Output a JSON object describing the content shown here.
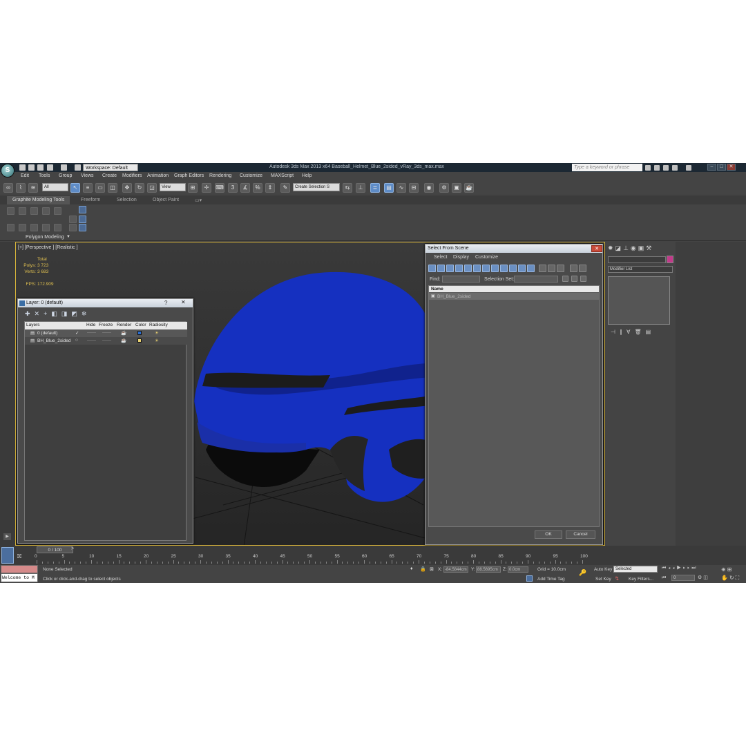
{
  "app": {
    "window_title": "Autodesk 3ds Max  2013 x64      Baseball_Helmet_Blue_2sided_vRay_3ds_max.max",
    "workspace": "Workspace: Default",
    "search_placeholder": "Type a keyword or phrase"
  },
  "menu": [
    "Edit",
    "Tools",
    "Group",
    "Views",
    "Create",
    "Modifiers",
    "Animation",
    "Graph Editors",
    "Rendering",
    "Customize",
    "MAXScript",
    "Help"
  ],
  "toolbar": {
    "filter": "All",
    "ref_coord": "View",
    "selection_set": "Create Selection S"
  },
  "ribbon": {
    "tabs": [
      "Graphite Modeling Tools",
      "Freeform",
      "Selection",
      "Object Paint"
    ],
    "panel_label": "Polygon Modeling"
  },
  "viewport": {
    "label": "[+] [Perspective ] [Realistic ]",
    "stats_header": "Total",
    "polys_label": "Polys:",
    "polys_value": "3 723",
    "verts_label": "Verts:",
    "verts_value": "3 683",
    "fps_label": "FPS:",
    "fps_value": "172.909",
    "helmet_color": "#1530c0"
  },
  "layer_dialog": {
    "title": "Layer: 0 (default)",
    "help": "?",
    "close": "✕",
    "columns": [
      "Layers",
      "Hide",
      "Freeze",
      "Render",
      "Color",
      "Radiosity"
    ],
    "rows": [
      {
        "name": "0 (default)",
        "hide": "——",
        "freeze": "——"
      },
      {
        "name": "BH_Blue_2sided",
        "hide": "——",
        "freeze": "——"
      }
    ]
  },
  "select_dialog": {
    "title": "Select From Scene",
    "menu": [
      "Select",
      "Display",
      "Customize"
    ],
    "find_label": "Find:",
    "selection_set_label": "Selection Set:",
    "column_name": "Name",
    "items": [
      "BH_Blue_2sided"
    ],
    "ok": "OK",
    "cancel": "Cancel"
  },
  "command_panel": {
    "modifier_list": "Modifier List"
  },
  "timeline": {
    "frame": "0 / 100",
    "ticks": [
      "0",
      "5",
      "10",
      "15",
      "20",
      "25",
      "30",
      "35",
      "40",
      "45",
      "50",
      "55",
      "60",
      "65",
      "70",
      "75",
      "80",
      "85",
      "90",
      "95",
      "100"
    ]
  },
  "status": {
    "script_listener": "Welcome to M",
    "selection": "None Selected",
    "prompt": "Click or click-and-drag to select objects",
    "x_label": "X:",
    "x_value": "-84.5844cm",
    "y_label": "Y:",
    "y_value": "88.5695cm",
    "z_label": "Z:",
    "z_value": "0.0cm",
    "grid": "Grid = 10.0cm",
    "add_time_tag": "Add Time Tag",
    "auto_key": "Auto Key",
    "set_key": "Set Key",
    "key_mode": "Selected",
    "key_filters": "Key Filters...",
    "frame_field": "0"
  }
}
